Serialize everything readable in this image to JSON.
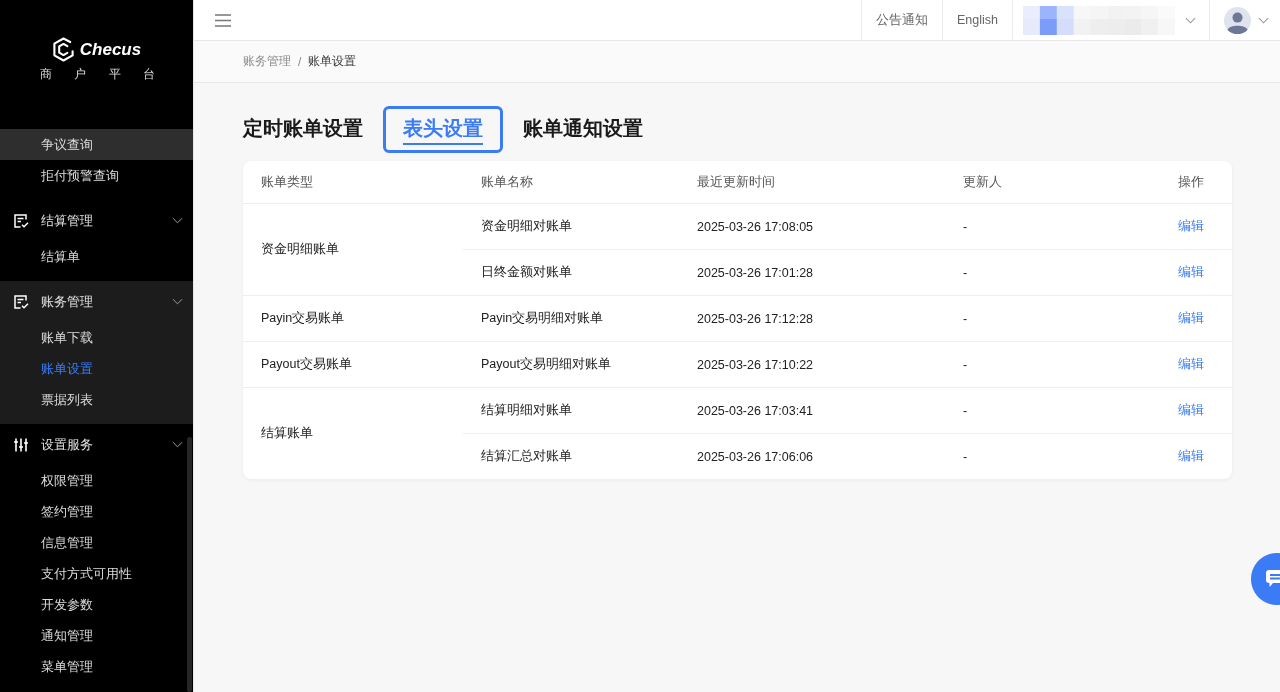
{
  "topbar": {
    "notice": "公告通知",
    "language": "English"
  },
  "sidebar": {
    "logo": {
      "name": "Checus",
      "subtitle": "商 户 平 台"
    },
    "menu": [
      {
        "kind": "items",
        "children": [
          {
            "label": "争议查询",
            "selected": false,
            "hovered": true
          },
          {
            "label": "拒付预警查询",
            "selected": false,
            "hovered": false
          }
        ]
      },
      {
        "kind": "group",
        "label": "结算管理",
        "expanded": true,
        "active": false,
        "children": [
          {
            "label": "结算单",
            "selected": false,
            "hovered": false
          }
        ]
      },
      {
        "kind": "group",
        "label": "账务管理",
        "expanded": true,
        "active": true,
        "children": [
          {
            "label": "账单下载",
            "selected": false,
            "hovered": false
          },
          {
            "label": "账单设置",
            "selected": true,
            "hovered": false
          },
          {
            "label": "票据列表",
            "selected": false,
            "hovered": false
          }
        ]
      },
      {
        "kind": "group",
        "label": "设置服务",
        "expanded": true,
        "active": false,
        "children": [
          {
            "label": "权限管理",
            "selected": false,
            "hovered": false
          },
          {
            "label": "签约管理",
            "selected": false,
            "hovered": false
          },
          {
            "label": "信息管理",
            "selected": false,
            "hovered": false
          },
          {
            "label": "支付方式可用性",
            "selected": false,
            "hovered": false
          },
          {
            "label": "开发参数",
            "selected": false,
            "hovered": false
          },
          {
            "label": "通知管理",
            "selected": false,
            "hovered": false
          },
          {
            "label": "菜单管理",
            "selected": false,
            "hovered": false
          }
        ]
      }
    ]
  },
  "breadcrumb": {
    "items": [
      "账务管理",
      "账单设置"
    ],
    "separator": "/"
  },
  "tabs": [
    {
      "label": "定时账单设置",
      "selected": false
    },
    {
      "label": "表头设置",
      "selected": true
    },
    {
      "label": "账单通知设置",
      "selected": false
    }
  ],
  "table": {
    "columns": [
      "账单类型",
      "账单名称",
      "最近更新时间",
      "更新人",
      "操作"
    ],
    "groups": [
      {
        "type": "资金明细账单",
        "rows": [
          {
            "name": "资金明细对账单",
            "updated": "2025-03-26 17:08:05",
            "updater": "-",
            "action": "编辑"
          },
          {
            "name": "日终金额对账单",
            "updated": "2025-03-26 17:01:28",
            "updater": "-",
            "action": "编辑"
          }
        ]
      },
      {
        "type": "Payin交易账单",
        "rows": [
          {
            "name": "Payin交易明细对账单",
            "updated": "2025-03-26 17:12:28",
            "updater": "-",
            "action": "编辑"
          }
        ]
      },
      {
        "type": "Payout交易账单",
        "rows": [
          {
            "name": "Payout交易明细对账单",
            "updated": "2025-03-26 17:10:22",
            "updater": "-",
            "action": "编辑"
          }
        ]
      },
      {
        "type": "结算账单",
        "rows": [
          {
            "name": "结算明细对账单",
            "updated": "2025-03-26 17:03:41",
            "updater": "-",
            "action": "编辑"
          },
          {
            "name": "结算汇总对账单",
            "updated": "2025-03-26 17:06:06",
            "updater": "-",
            "action": "编辑"
          }
        ]
      }
    ]
  }
}
